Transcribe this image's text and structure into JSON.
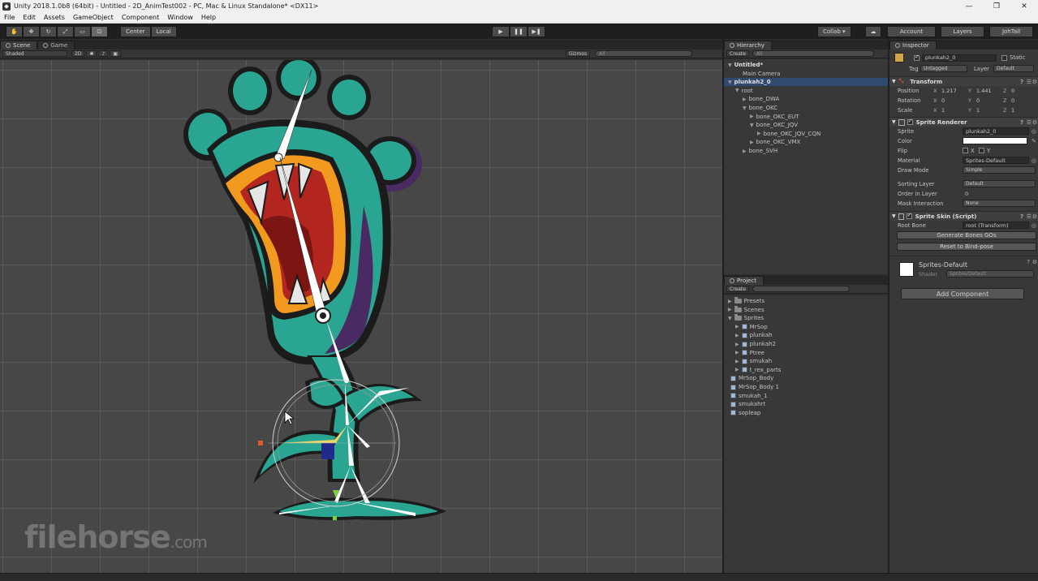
{
  "window": {
    "title": "Unity 2018.1.0b8 (64bit) - Untitled - 2D_AnimTest002 - PC, Mac & Linux Standalone* <DX11>",
    "controls": [
      "—",
      "❐",
      "✕"
    ]
  },
  "menu": [
    "File",
    "Edit",
    "Assets",
    "GameObject",
    "Component",
    "Window",
    "Help"
  ],
  "toolbar": {
    "pivot_center": "Center",
    "pivot_local": "Local",
    "collab": "Collab ▾",
    "account": "Account",
    "layers": "Layers",
    "layout": "JohTall"
  },
  "scene": {
    "tabs": [
      "Scene",
      "Game"
    ],
    "shading": "Shaded",
    "mode_2d": "2D",
    "gizmos": "Gizmos",
    "search_placeholder": "All"
  },
  "hierarchy": {
    "tab": "Hierarchy",
    "create": "Create",
    "search_placeholder": "All",
    "items": [
      {
        "label": "Untitled*",
        "indent": 0,
        "arrow": "▼",
        "bold": true
      },
      {
        "label": "Main Camera",
        "indent": 1,
        "arrow": ""
      },
      {
        "label": "plunkah2_0",
        "indent": 0,
        "arrow": "▼",
        "selected": true,
        "bold": true
      },
      {
        "label": "root",
        "indent": 1,
        "arrow": "▼"
      },
      {
        "label": "bone_DWA",
        "indent": 2,
        "arrow": "▶"
      },
      {
        "label": "bone_OKC",
        "indent": 2,
        "arrow": "▼"
      },
      {
        "label": "bone_OKC_EUT",
        "indent": 3,
        "arrow": "▶"
      },
      {
        "label": "bone_OKC_JQV",
        "indent": 3,
        "arrow": "▼"
      },
      {
        "label": "bone_OKC_JQV_CQN",
        "indent": 4,
        "arrow": "▶"
      },
      {
        "label": "bone_OKC_VMX",
        "indent": 3,
        "arrow": "▶"
      },
      {
        "label": "bone_SVH",
        "indent": 2,
        "arrow": "▶"
      }
    ]
  },
  "project": {
    "tab": "Project",
    "create": "Create",
    "items": [
      {
        "label": "Presets",
        "indent": 0,
        "arrow": "▶",
        "kind": "folder"
      },
      {
        "label": "Scenes",
        "indent": 0,
        "arrow": "▶",
        "kind": "folder"
      },
      {
        "label": "Sprites",
        "indent": 0,
        "arrow": "▼",
        "kind": "folder"
      },
      {
        "label": "MrSop",
        "indent": 1,
        "arrow": "▶",
        "kind": "sprite"
      },
      {
        "label": "plunkah",
        "indent": 1,
        "arrow": "▶",
        "kind": "sprite"
      },
      {
        "label": "plunkah2",
        "indent": 1,
        "arrow": "▶",
        "kind": "sprite"
      },
      {
        "label": "Ptree",
        "indent": 1,
        "arrow": "▶",
        "kind": "sprite"
      },
      {
        "label": "smukah",
        "indent": 1,
        "arrow": "▶",
        "kind": "sprite"
      },
      {
        "label": "t_rex_parts",
        "indent": 1,
        "arrow": "▶",
        "kind": "sprite"
      },
      {
        "label": "MrSop_Body",
        "indent": 0,
        "arrow": "",
        "kind": "sprite"
      },
      {
        "label": "MrSop_Body 1",
        "indent": 0,
        "arrow": "",
        "kind": "sprite"
      },
      {
        "label": "smukah_1",
        "indent": 0,
        "arrow": "",
        "kind": "sprite"
      },
      {
        "label": "smukahrt",
        "indent": 0,
        "arrow": "",
        "kind": "sprite"
      },
      {
        "label": "sopleap",
        "indent": 0,
        "arrow": "",
        "kind": "sprite"
      }
    ]
  },
  "inspector": {
    "tab": "Inspector",
    "object_name": "plunkah2_0",
    "static": "Static",
    "tag_label": "Tag",
    "tag_value": "Untagged",
    "layer_label": "Layer",
    "layer_value": "Default",
    "transform": {
      "title": "Transform",
      "rows": [
        {
          "label": "Position",
          "x": "1.217",
          "y": "1.441",
          "z": "0"
        },
        {
          "label": "Rotation",
          "x": "0",
          "y": "0",
          "z": "0"
        },
        {
          "label": "Scale",
          "x": "1",
          "y": "1",
          "z": "1"
        }
      ]
    },
    "sprite_renderer": {
      "title": "Sprite Renderer",
      "sprite_label": "Sprite",
      "sprite_value": "plunkah2_0",
      "color_label": "Color",
      "flip_label": "Flip",
      "flip_x": "X",
      "flip_y": "Y",
      "material_label": "Material",
      "material_value": "Sprites-Default",
      "draw_mode_label": "Draw Mode",
      "draw_mode_value": "Simple",
      "sorting_layer_label": "Sorting Layer",
      "sorting_layer_value": "Default",
      "order_label": "Order in Layer",
      "order_value": "0",
      "mask_label": "Mask Interaction",
      "mask_value": "None"
    },
    "sprite_skin": {
      "title": "Sprite Skin (Script)",
      "root_bone_label": "Root Bone",
      "root_bone_value": "root (Transform)",
      "generate_button": "Generate Bones GOs",
      "reset_button": "Reset to Bind-pose"
    },
    "material": {
      "name": "Sprites-Default",
      "shader_label": "Shader",
      "shader_value": "Sprites/Default"
    },
    "add_component": "Add Component"
  },
  "watermark": {
    "main": "filehorse",
    "suffix": ".com"
  },
  "colors": {
    "accent_selection": "#2f4a6e",
    "creature_teal": "#2aa592",
    "creature_orange": "#f29a1f",
    "mouth_red": "#b2261f"
  }
}
